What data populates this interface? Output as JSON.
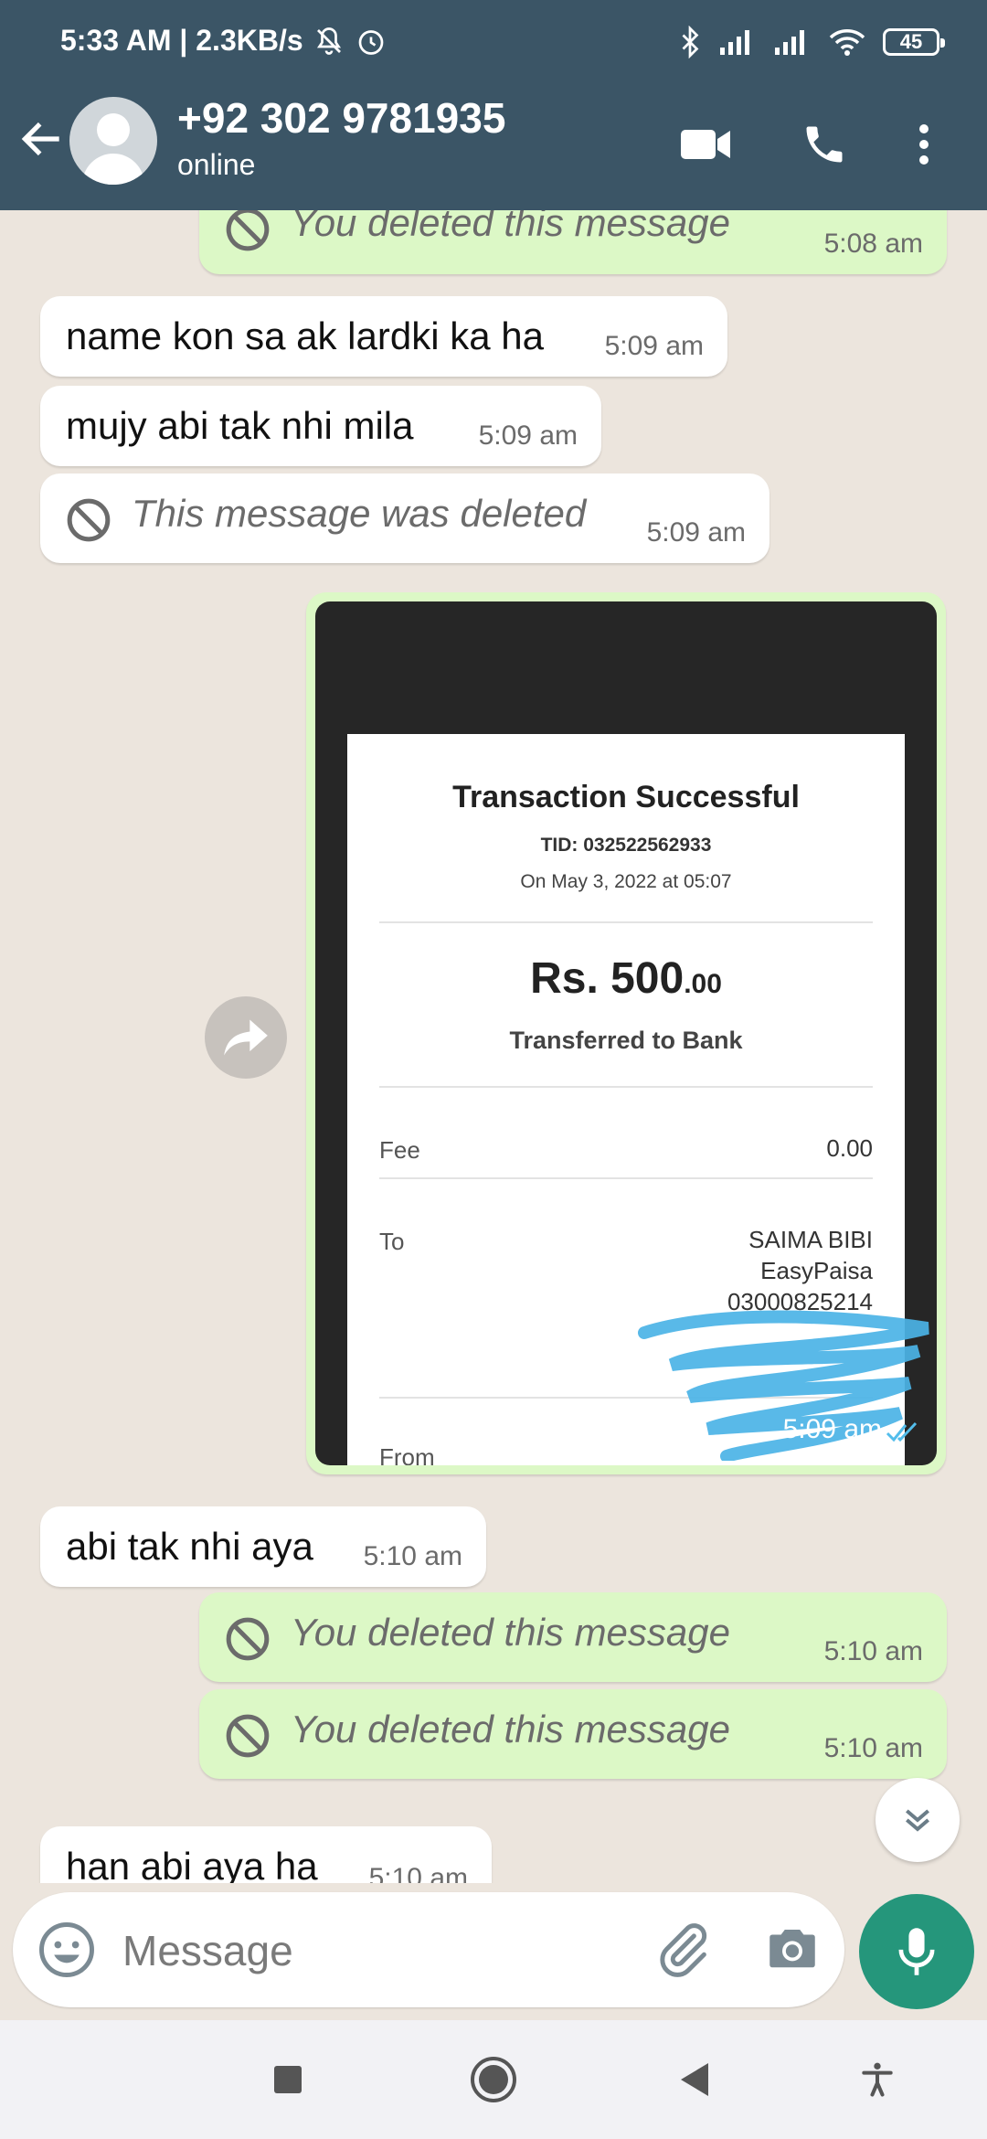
{
  "status_bar": {
    "time_speed": "5:33 AM | 2.3KB/s",
    "battery": "45"
  },
  "header": {
    "contact_name": "+92 302 9781935",
    "contact_status": "online"
  },
  "messages": [
    {
      "type": "deleted",
      "direction": "out",
      "text": "You deleted this message",
      "time": "5:08 am"
    },
    {
      "type": "text",
      "direction": "in",
      "text": "name kon sa ak lardki ka ha",
      "time": "5:09 am"
    },
    {
      "type": "text",
      "direction": "in",
      "text": "mujy abi tak nhi mila",
      "time": "5:09 am"
    },
    {
      "type": "deleted",
      "direction": "in",
      "text": "This message was deleted",
      "time": "5:09 am"
    },
    {
      "type": "image",
      "direction": "out",
      "time": "5:09 am"
    },
    {
      "type": "text",
      "direction": "in",
      "text": "abi tak nhi aya",
      "time": "5:10 am"
    },
    {
      "type": "deleted",
      "direction": "out",
      "text": "You deleted this message",
      "time": "5:10 am"
    },
    {
      "type": "deleted",
      "direction": "out",
      "text": "You deleted this message",
      "time": "5:10 am"
    },
    {
      "type": "text",
      "direction": "in",
      "text": "han abi aya ha",
      "time": "5:10 am"
    }
  ],
  "receipt": {
    "title": "Transaction Successful",
    "tid": "TID: 032522562933",
    "date": "On May 3, 2022 at 05:07",
    "amount_main": "Rs. 500",
    "amount_decimal": ".00",
    "transfer_type": "Transferred to Bank",
    "fee_label": "Fee",
    "fee_value": "0.00",
    "to_label": "To",
    "to_name": "SAIMA BIBI",
    "to_bank": "EasyPaisa",
    "to_account": "03000825214",
    "from_label": "From"
  },
  "input": {
    "placeholder": "Message"
  },
  "colors": {
    "header_bg": "#3b5566",
    "chat_bg": "#ece5dd",
    "outgoing_bubble": "#dcf8c6",
    "incoming_bubble": "#ffffff",
    "mic_button": "#25967b",
    "read_ticks": "#53bdeb"
  }
}
